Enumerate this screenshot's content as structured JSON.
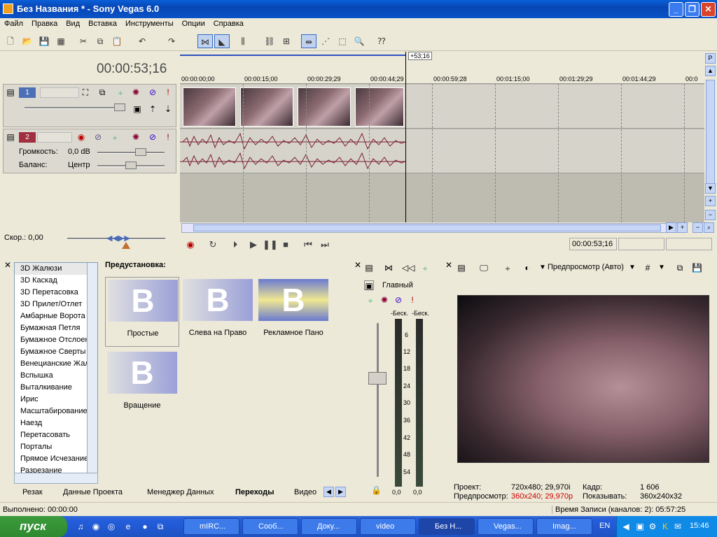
{
  "window": {
    "title": "Без Названия * - Sony Vegas 6.0"
  },
  "menu": [
    "Файл",
    "Правка",
    "Вид",
    "Вставка",
    "Инструменты",
    "Опции",
    "Справка"
  ],
  "timeline": {
    "cursor_time": "00:00:53;16",
    "marker": "+53;16",
    "ruler_ticks": [
      "00:00:00;00",
      "00:00:15;00",
      "00:00:29;29",
      "00:00:44;29",
      "00:00:59;28",
      "00:01:15;00",
      "00:01:29;29",
      "00:01:44;29",
      "00:0"
    ],
    "video_track": {
      "number": "1"
    },
    "audio_track": {
      "number": "2",
      "volume_label": "Громкость:",
      "volume_value": "0,0 dB",
      "pan_label": "Баланс:",
      "pan_value": "Центр"
    }
  },
  "transport": {
    "rate_label": "Скор.: 0,00",
    "timecode": "00:00:53;16"
  },
  "transitions": {
    "items": [
      "3D Жалюзи",
      "3D Каскад",
      "3D Перетасовка",
      "3D Прилет/Отлет",
      "Амбарные Ворота",
      "Бумажная Петля",
      "Бумажное Отслоен",
      "Бумажное Сверты",
      "Венецианские Жал",
      "Вспышка",
      "Выталкивание",
      "Ирис",
      "Масштабирование",
      "Наезд",
      "Перетасовать",
      "Порталы",
      "Прямое Исчезание",
      "Разрезание"
    ],
    "preset_label": "Предустановка:",
    "presets": [
      "Простые",
      "Слева на Право",
      "Рекламное Пано",
      "Вращение"
    ]
  },
  "tabs": [
    "Резак",
    "Данные Проекта",
    "Менеджер Данных",
    "Переходы",
    "Видео"
  ],
  "mixer": {
    "bus_label": "Главный",
    "peak_left": "-Беск.",
    "peak_right": "-Беск.",
    "scale": [
      "6",
      "12",
      "18",
      "24",
      "30",
      "36",
      "42",
      "48",
      "54"
    ],
    "value_left": "0,0",
    "value_right": "0,0"
  },
  "preview": {
    "mode": "Предпросмотр (Авто)",
    "project_label": "Проект:",
    "project_value": "720x480; 29,970i",
    "preview_label": "Предпросмотр:",
    "preview_value": "360x240; 29,970p",
    "frame_label": "Кадр:",
    "frame_value": "1 606",
    "display_label": "Показывать:",
    "display_value": "360x240x32"
  },
  "status": {
    "left": "Выполнено: 00:00:00",
    "right": "Время Записи (каналов: 2): 05:57:25"
  },
  "taskbar": {
    "start": "пуск",
    "tasks": [
      "mIRC...",
      "Сооб...",
      "Доку...",
      "video",
      "Без Н...",
      "Vegas...",
      "Imag..."
    ],
    "lang": "EN",
    "clock": "15:46"
  },
  "colors": {
    "accent": "#316ac5",
    "audio_wave": "#7a2030",
    "preview_red": "#cc0000"
  }
}
